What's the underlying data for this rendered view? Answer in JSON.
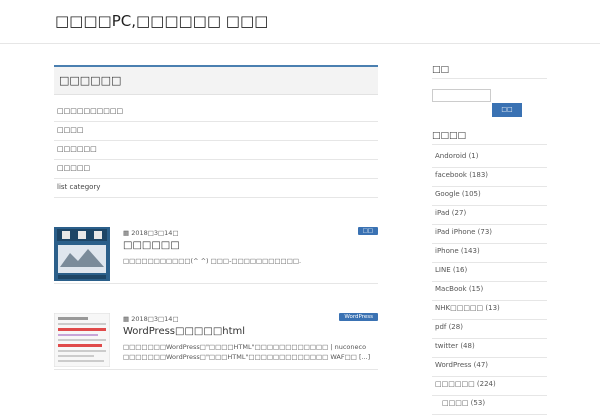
{
  "site": {
    "title": "□□□□PC,□□□□□□ □□□"
  },
  "main": {
    "page_title": "□□□□□□",
    "categories": [
      "□□□□□□□□□□",
      "□□□□",
      "□□□□□□",
      "□□□□□",
      "list category"
    ]
  },
  "posts": [
    {
      "date": "▦ 2018□3□14□",
      "badge": "□□",
      "title": "□□□□□□",
      "excerpt": "□□□□□□□□□□□(^ ^) □□□-□□□□□□□□□□□."
    },
    {
      "date": "▦ 2018□3□14□",
      "badge": "WordPress",
      "title": "WordPress□□□□□html",
      "excerpt": "□□□□□□□WordPress□\"□□□□HTML\"□□□□□□□□□□□□ | nuconeco □□□□□□□WordPress□\"□□□HTML\"□□□□□□□□□□□□□ WAF□□ [...]"
    }
  ],
  "sidebar": {
    "search": {
      "title": "□□",
      "button": "□□",
      "placeholder": ""
    },
    "archive": {
      "title": "□□□□",
      "items": [
        "Andoroid (1)",
        "facebook (183)",
        "Google (105)",
        "iPad (27)",
        "iPad iPhone (73)",
        "iPhone (143)",
        "LINE (16)",
        "MacBook (15)",
        "NHK□□□□□ (13)",
        "pdf (28)",
        "twitter (48)",
        "WordPress (47)",
        "□□□□□□ (224)",
        "□□□□ (53)"
      ]
    }
  },
  "colors": {
    "accent": "#3a72b3",
    "border": "#e6e6e6"
  }
}
